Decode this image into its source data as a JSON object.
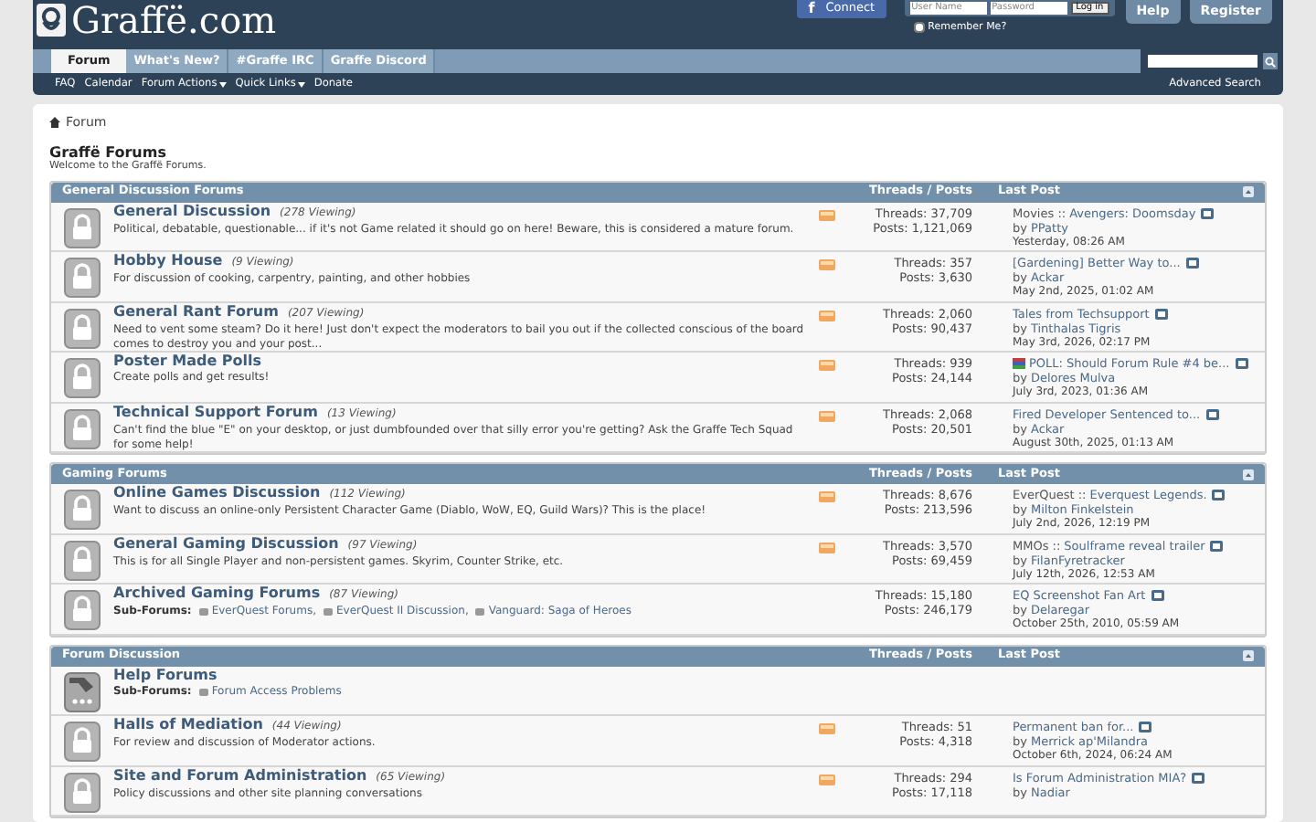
{
  "header": {
    "logo": "Graffë.com",
    "connect_glyph": "f",
    "connect": "Connect",
    "username": {
      "placeholder": "User Name"
    },
    "password": {
      "placeholder": "Password"
    },
    "login": "Log in",
    "remember": {
      "label": "Remember Me?",
      "checked": false
    },
    "buttons": [
      "Help",
      "Register"
    ]
  },
  "tabs": [
    {
      "label": "Forum",
      "selected": true
    },
    {
      "label": "What's New?",
      "selected": false
    },
    {
      "label": "#Graffe IRC",
      "selected": false
    },
    {
      "label": "Graffe Discord",
      "selected": false
    }
  ],
  "subnav": [
    {
      "label": "FAQ",
      "dropdown": false
    },
    {
      "label": "Calendar",
      "dropdown": false
    },
    {
      "label": "Forum Actions",
      "dropdown": true
    },
    {
      "label": "Quick Links",
      "dropdown": true
    },
    {
      "label": "Donate",
      "dropdown": false
    }
  ],
  "advanced_search": "Advanced Search",
  "breadcrumb": "Forum",
  "page_title": "Graffë Forums",
  "welcome": "Welcome to the Graffë Forums.",
  "sections": [
    {
      "title": "General Discussion Forums",
      "col_stats": "Threads / Posts",
      "col_last": "Last Post",
      "forums": [
        {
          "kind": "lock",
          "title": "General Discussion",
          "viewing": "(278 Viewing)",
          "description": "Political, debatable, questionable... if it's not Game related it should go on here! Beware, this is considered a mature forum.",
          "rss": true,
          "threads": "Threads: 37,709",
          "posts": "Posts: 1,121,069",
          "last": {
            "poll": false,
            "prefix": "Movies ::",
            "title": "Avengers: Doomsday",
            "by": "by",
            "author": "PPatty",
            "date": "Yesterday, 08:26 AM"
          }
        },
        {
          "kind": "lock",
          "title": "Hobby House",
          "viewing": "(9 Viewing)",
          "description": "For discussion of cooking, carpentry, painting, and other hobbies",
          "rss": true,
          "threads": "Threads: 357",
          "posts": "Posts: 3,630",
          "last": {
            "poll": false,
            "title": "[Gardening] Better Way to...",
            "by": "by",
            "author": "Ackar",
            "date": "May 2nd, 2025, 01:02 AM"
          }
        },
        {
          "kind": "lock",
          "title": "General Rant Forum",
          "viewing": "(207 Viewing)",
          "description": "Need to vent some steam? Do it here! Just don't expect the moderators to bail you out if the collected conscious of the board comes to destroy you and your post...",
          "rss": true,
          "threads": "Threads: 2,060",
          "posts": "Posts: 90,437",
          "last": {
            "poll": false,
            "title": "Tales from Techsupport",
            "by": "by",
            "author": "Tinthalas Tigris",
            "date": "May 3rd, 2026, 02:17 PM"
          }
        },
        {
          "kind": "lock",
          "title": "Poster Made Polls",
          "description": "Create polls and get results!",
          "rss": true,
          "threads": "Threads: 939",
          "posts": "Posts: 24,144",
          "last": {
            "poll": true,
            "title": "POLL: Should Forum Rule #4 be...",
            "by": "by",
            "author": "Delores Mulva",
            "date": "July 3rd, 2023, 01:36 AM"
          }
        },
        {
          "kind": "lock",
          "title": "Technical Support Forum",
          "viewing": "(13 Viewing)",
          "description": "Can't find the blue \"E\" on your desktop, or just dumbfounded over that silly error you're getting? Ask the Graffe Tech Squad for some help!",
          "rss": true,
          "threads": "Threads: 2,068",
          "posts": "Posts: 20,501",
          "last": {
            "poll": false,
            "title": "Fired Developer Sentenced to...",
            "by": "by",
            "author": "Ackar",
            "date": "August 30th, 2025, 01:13 AM"
          }
        }
      ]
    },
    {
      "title": "Gaming Forums",
      "col_stats": "Threads / Posts",
      "col_last": "Last Post",
      "forums": [
        {
          "kind": "lock",
          "title": "Online Games Discussion",
          "viewing": "(112 Viewing)",
          "description": "Want to discuss an online-only Persistent Character Game (Diablo, WoW, EQ, Guild Wars)? This is the place!",
          "rss": true,
          "threads": "Threads: 8,676",
          "posts": "Posts: 213,596",
          "last": {
            "poll": false,
            "prefix": "EverQuest ::",
            "title": "Everquest Legends.",
            "by": "by",
            "author": "Milton Finkelstein",
            "date": "July 2nd, 2026, 12:19 PM"
          }
        },
        {
          "kind": "lock",
          "title": "General Gaming Discussion",
          "viewing": "(97 Viewing)",
          "description": "This is for all Single Player and non-persistent games. Skyrim, Counter Strike, etc.",
          "rss": true,
          "threads": "Threads: 3,570",
          "posts": "Posts: 69,459",
          "last": {
            "poll": false,
            "prefix": "MMOs ::",
            "title": "Soulframe reveal trailer",
            "by": "by",
            "author": "FilanFyretracker",
            "date": "July 12th, 2026, 12:53 AM"
          }
        },
        {
          "kind": "lock",
          "title": "Archived Gaming Forums",
          "viewing": "(87 Viewing)",
          "subforums_label": "Sub-Forums:",
          "subforums": [
            "EverQuest Forums,",
            "EverQuest II Discussion,",
            "Vanguard: Saga of Heroes"
          ],
          "rss": false,
          "threads": "Threads: 15,180",
          "posts": "Posts: 246,179",
          "last": {
            "poll": false,
            "title": "EQ Screenshot Fan Art",
            "by": "by",
            "author": "Delaregar",
            "date": "October 25th, 2010, 05:59 AM"
          }
        }
      ]
    },
    {
      "title": "Forum Discussion",
      "col_stats": "Threads / Posts",
      "col_last": "Last Post",
      "forums": [
        {
          "kind": "link",
          "title": "Help Forums",
          "subforums_label": "Sub-Forums:",
          "subforums": [
            "Forum Access Problems"
          ],
          "rss": false
        },
        {
          "kind": "lock",
          "title": "Halls of Mediation",
          "viewing": "(44 Viewing)",
          "description": "For review and discussion of Moderator actions.",
          "rss": true,
          "threads": "Threads: 51",
          "posts": "Posts: 4,318",
          "last": {
            "poll": false,
            "title": "Permanent ban for...",
            "by": "by",
            "author": "Merrick ap'Milandra",
            "date": "October 6th, 2024, 06:24 AM"
          }
        },
        {
          "kind": "lock",
          "title": "Site and Forum Administration",
          "viewing": "(65 Viewing)",
          "description": "Policy discussions and other site planning conversations",
          "rss": true,
          "threads": "Threads: 294",
          "posts": "Posts: 17,118",
          "last": {
            "poll": false,
            "title": "Is Forum Administration MIA?",
            "by": "by",
            "author": "Nadiar"
          }
        }
      ]
    }
  ]
}
